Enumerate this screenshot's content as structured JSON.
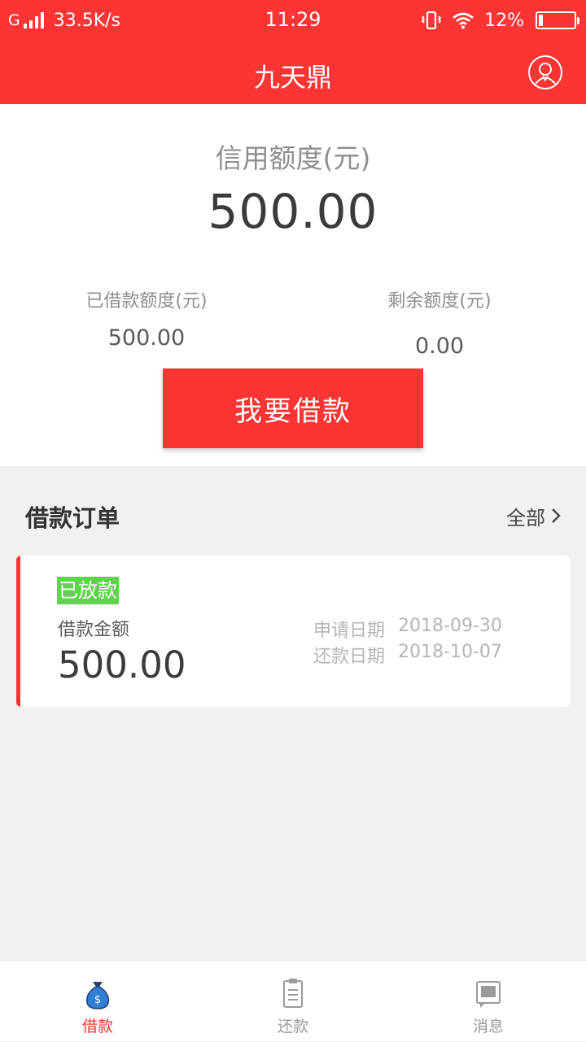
{
  "status_bar": {
    "network_type": "G",
    "speed": "33.5K/s",
    "time": "11:29",
    "battery_percent": "12%",
    "battery_level": 0.12
  },
  "header": {
    "title": "九天鼎",
    "user_icon": "user-avatar-icon"
  },
  "summary": {
    "credit_label": "信用额度(元)",
    "credit_value": "500.00",
    "borrowed_label": "已借款额度(元)",
    "borrowed_value": "500.00",
    "remaining_label": "剩余额度(元)",
    "remaining_value": "0.00",
    "borrow_button": "我要借款"
  },
  "orders": {
    "title": "借款订单",
    "all_label": "全部",
    "items": [
      {
        "status": "已放款",
        "amount_label": "借款金额",
        "amount": "500.00",
        "apply_date_label": "申请日期",
        "apply_date": "2018-09-30",
        "repay_date_label": "还款日期",
        "repay_date": "2018-10-07"
      }
    ]
  },
  "tabs": [
    {
      "label": "借款",
      "icon": "money-bag-icon",
      "active": true
    },
    {
      "label": "还款",
      "icon": "clipboard-icon",
      "active": false
    },
    {
      "label": "消息",
      "icon": "message-icon",
      "active": false
    }
  ],
  "colors": {
    "brand_red": "#fc3433",
    "status_green": "#5ed44c",
    "background": "#f0f1f0",
    "active_tab_icon_blue": "#2f7fd6"
  }
}
